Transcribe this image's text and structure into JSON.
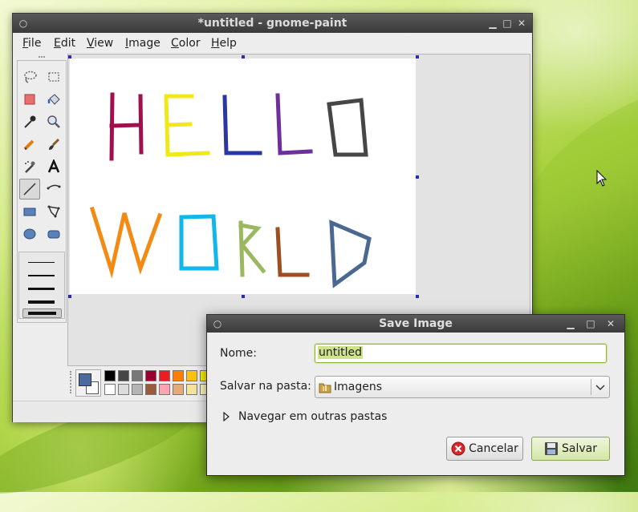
{
  "main_window": {
    "title": "*untitled - gnome-paint",
    "menu": [
      {
        "pre": "",
        "key": "F",
        "post": "ile"
      },
      {
        "pre": "",
        "key": "E",
        "post": "dit"
      },
      {
        "pre": "",
        "key": "V",
        "post": "iew"
      },
      {
        "pre": "",
        "key": "I",
        "post": "mage"
      },
      {
        "pre": "",
        "key": "C",
        "post": "olor"
      },
      {
        "pre": "",
        "key": "H",
        "post": "elp"
      }
    ],
    "tools": [
      "free-select",
      "rect-select",
      "eraser",
      "fill",
      "color-picker",
      "zoom",
      "pencil",
      "paintbrush",
      "airbrush",
      "text",
      "line",
      "bezier",
      "rectangle",
      "polygon",
      "ellipse",
      "rounded-rectangle"
    ],
    "active_tool": "line",
    "canvas_text": {
      "line1": [
        {
          "letter": "H",
          "color": "#a0104c"
        },
        {
          "letter": "E",
          "color": "#f1e81a"
        },
        {
          "letter": "L",
          "color": "#2a37a0"
        },
        {
          "letter": "L",
          "color": "#6d2f9c"
        },
        {
          "letter": "O",
          "color": "#464646"
        }
      ],
      "line2": [
        {
          "letter": "W",
          "color": "#f28a14"
        },
        {
          "letter": "O",
          "color": "#12b6e8"
        },
        {
          "letter": "R",
          "color": "#9ab860"
        },
        {
          "letter": "L",
          "color": "#9c4f22"
        },
        {
          "letter": "D",
          "color": "#4b6890"
        }
      ]
    },
    "primary_color": "#4a6aa0",
    "secondary_color": "#ffffff",
    "palette_top": [
      "#000000",
      "#464646",
      "#787878",
      "#990030",
      "#ed1c24",
      "#ff7e00",
      "#ffc20e",
      "#fff200"
    ],
    "palette_bottom": [
      "#ffffff",
      "#dcdcdc",
      "#b4b4b4",
      "#9c5a3c",
      "#ffa3b1",
      "#e5aa7a",
      "#f5e49c",
      "#fff9bd"
    ]
  },
  "dialog": {
    "title": "Save Image",
    "name_label": "Nome:",
    "name_value": "untitled",
    "folder_label": "Salvar na pasta:",
    "folder_value": "Imagens",
    "browse_label": "Navegar em outras pastas",
    "cancel_label": "Cancelar",
    "save_label": "Salvar"
  }
}
